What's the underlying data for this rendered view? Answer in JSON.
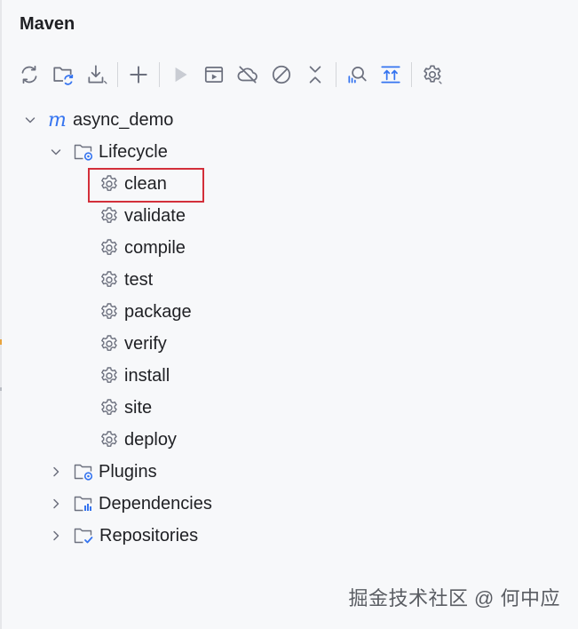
{
  "panel": {
    "title": "Maven"
  },
  "toolbar": {
    "buttons": [
      {
        "icon": "reload-icon"
      },
      {
        "icon": "folder-sync-icon"
      },
      {
        "icon": "download-icon"
      },
      {
        "icon": "add-icon"
      },
      {
        "icon": "run-icon"
      },
      {
        "icon": "run-config-icon"
      },
      {
        "icon": "offline-icon"
      },
      {
        "icon": "skip-tests-icon"
      },
      {
        "icon": "collapse-all-icon"
      },
      {
        "icon": "analyze-dependencies-icon"
      },
      {
        "icon": "show-goals-icon"
      },
      {
        "icon": "settings-icon"
      }
    ]
  },
  "tree": {
    "project": {
      "label": "async_demo",
      "expanded": true
    },
    "lifecycle": {
      "label": "Lifecycle",
      "expanded": true,
      "phases": [
        "clean",
        "validate",
        "compile",
        "test",
        "package",
        "verify",
        "install",
        "site",
        "deploy"
      ],
      "selected": "clean"
    },
    "plugins": {
      "label": "Plugins",
      "expanded": false
    },
    "dependencies": {
      "label": "Dependencies",
      "expanded": false
    },
    "repositories": {
      "label": "Repositories",
      "expanded": false
    }
  },
  "watermark": {
    "text": "掘金技术社区 @ 何中应"
  },
  "colors": {
    "highlight": "#d32f3a",
    "maven_logo": "#3574f0",
    "folder_badge": "#3574f0"
  }
}
